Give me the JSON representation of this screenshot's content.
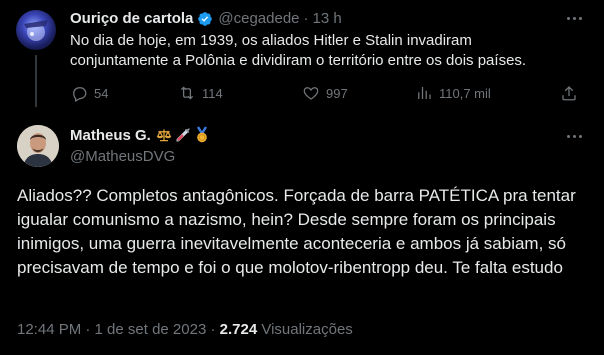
{
  "reply_parent": {
    "display_name": "Ouriço de cartola",
    "handle": "@cegadede",
    "separator": "·",
    "time": "13 h",
    "text": "No dia de hoje, em 1939, os aliados Hitler e Stalin invadiram conjuntamente a Polônia e dividiram o território entre os dois países.",
    "actions": {
      "replies": "54",
      "retweets": "114",
      "likes": "997",
      "views": "110,7 mil"
    },
    "verified": true
  },
  "main_tweet": {
    "display_name": "Matheus G.",
    "emojis": [
      "scales-emoji",
      "syringe-emoji",
      "medal-emoji"
    ],
    "handle": "@MatheusDVG",
    "text": "Aliados?? Completos antagônicos. Forçada de barra PATÉTICA pra tentar igualar comunismo a nazismo, hein? Desde sempre foram os principais inimigos, uma guerra inevitavelmente aconteceria e ambos já sabiam, só precisavam de tempo e foi o que molotov-ribentropp deu. Te falta estudo",
    "timestamp": "12:44 PM · 1 de set de 2023 · ",
    "views_count": "2.724",
    "views_label": " Visualizações"
  },
  "colors": {
    "background": "#000000",
    "text": "#e7e9ea",
    "muted": "#71767b",
    "verified": "#1d9bf0",
    "divider": "#2f3336"
  }
}
